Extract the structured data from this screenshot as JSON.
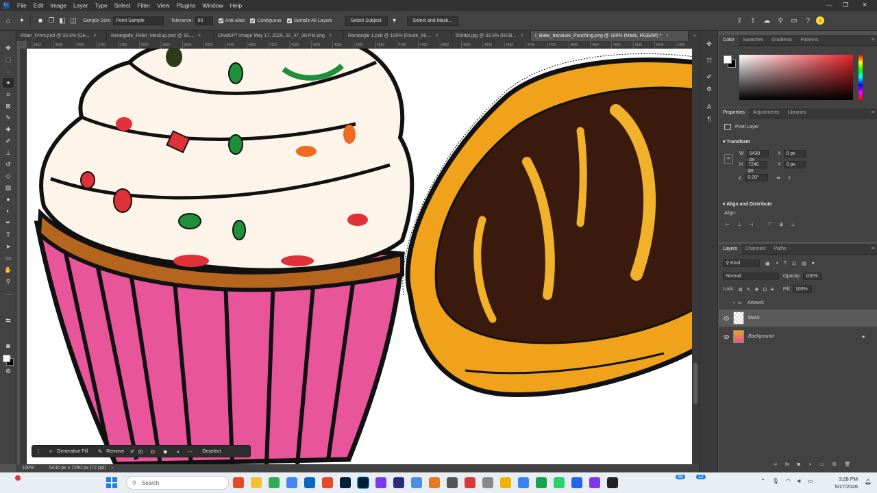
{
  "menubar": {
    "app_icon": "Ps",
    "items": [
      "File",
      "Edit",
      "Image",
      "Layer",
      "Type",
      "Select",
      "Filter",
      "View",
      "Plugins",
      "Window",
      "Help"
    ],
    "window_controls": [
      "minimize-icon",
      "maximize-icon",
      "close-icon"
    ]
  },
  "options": {
    "sample_size_label": "Sample Size:",
    "sample_size_value": "Point Sample",
    "tolerance_label": "Tolerance:",
    "tolerance_value": "80",
    "anti_alias": "Anti-alias",
    "contiguous": "Contiguous",
    "sample_all_layers": "Sample All Layers",
    "select_subject": "Select Subject",
    "select_and_mask": "Select and Mask..."
  },
  "tabs": [
    {
      "label": "Rider_Front.psd @ 33.3% (Ge...",
      "active": false
    },
    {
      "label": "Renegade_Rider_Mockup.psd @ 33....",
      "active": false
    },
    {
      "label": "ChatGPT Image May 17, 2026, 02_47_38 PM.png",
      "active": false
    },
    {
      "label": "Rectangle 1.psb @ 100% (Route_66,...",
      "active": false
    },
    {
      "label": "500dpi.jpg @ 33.3% (RGB...",
      "active": false
    },
    {
      "label": "I_Bake_because_Punching.png @ 100% (Mask, RGB/8#) *",
      "active": true
    }
  ],
  "ruler": {
    "ticks": [
      "3550",
      "3600",
      "3650",
      "3700",
      "3750",
      "3800",
      "3850",
      "3900",
      "3950",
      "4000",
      "4050",
      "4100",
      "4150",
      "4200",
      "4250",
      "4300",
      "4350",
      "4400",
      "4450",
      "4500",
      "4550",
      "4600",
      "4650",
      "4700",
      "4750",
      "4800",
      "4850",
      "4900",
      "4950",
      "5000",
      "5050"
    ]
  },
  "context_bar": {
    "generative_fill": "Generative Fill",
    "remove": "Remove",
    "deselect": "Deselect"
  },
  "status": {
    "zoom": "100%",
    "doc_info": "5430 px x 7240 px (72 ppi)"
  },
  "color_panel": {
    "tabs": [
      "Color",
      "Swatches",
      "Gradients",
      "Patterns"
    ],
    "fg": "#ffffff",
    "bg": "#000000"
  },
  "properties": {
    "tabs": [
      "Properties",
      "Adjustments",
      "Libraries"
    ],
    "layer_kind": "Pixel Layer",
    "transform_label": "Transform",
    "w_label": "W",
    "w_value": "5430 px",
    "h_label": "H",
    "h_value": "7240 px",
    "x_label": "X",
    "x_value": "0 px",
    "y_label": "Y",
    "y_value": "0 px",
    "angle_value": "0.00°",
    "align_label": "Align and Distribute",
    "align_sub": "Align:"
  },
  "layers_panel": {
    "tabs": [
      "Layers",
      "Channels",
      "Paths"
    ],
    "filter_kind": "Kind",
    "blend_mode": "Normal",
    "opacity_label": "Opacity:",
    "opacity_value": "100%",
    "lock_label": "Lock:",
    "fill_label": "Fill:",
    "fill_value": "100%",
    "layers": [
      {
        "name": "Artwork",
        "type": "group",
        "visible": false
      },
      {
        "name": "Mask",
        "type": "pixel",
        "visible": true,
        "selected": true
      },
      {
        "name": "Background",
        "type": "pixel",
        "visible": true,
        "locked": true
      }
    ]
  },
  "taskbar": {
    "search_placeholder": "Search",
    "time": "3:28 PM",
    "date": "5/17/2026",
    "badge_a": "68",
    "badge_b": "12"
  },
  "colors": {
    "accent": "#31a8ff",
    "pink": "#e9559b",
    "bread": "#f0a21b",
    "chocolate": "#3a1a0c",
    "frosting": "#fdf4ea"
  }
}
